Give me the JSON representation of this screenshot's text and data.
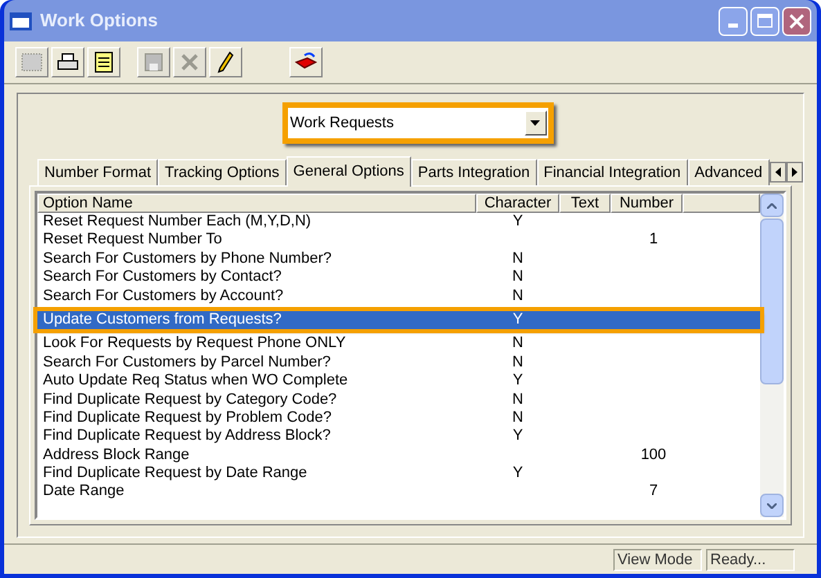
{
  "window": {
    "title": "Work Options"
  },
  "toolbar": [
    {
      "kind": "preview",
      "disabled": true
    },
    {
      "kind": "print",
      "disabled": false
    },
    {
      "kind": "document",
      "disabled": false
    },
    {
      "kind": "save",
      "disabled": true
    },
    {
      "kind": "delete",
      "disabled": true
    },
    {
      "kind": "edit",
      "disabled": false
    },
    {
      "kind": "exit",
      "disabled": false
    }
  ],
  "module_select": {
    "value": "Work Requests"
  },
  "tabs": [
    {
      "label": "Number Format",
      "selected": false
    },
    {
      "label": "Tracking Options",
      "selected": false
    },
    {
      "label": "General Options",
      "selected": true
    },
    {
      "label": "Parts Integration",
      "selected": false
    },
    {
      "label": "Financial Integration",
      "selected": false
    },
    {
      "label": "Advanced",
      "selected": false
    }
  ],
  "table": {
    "columns": [
      "Option Name",
      "Character",
      "Text",
      "Number"
    ],
    "rows": [
      {
        "name": "Reset Request Number Each (M,Y,D,N)",
        "character": "Y",
        "selected": false
      },
      {
        "name": "Reset Request Number To",
        "number": "1",
        "selected": false
      },
      {
        "name": "Search For Customers by Phone Number?",
        "character": "N",
        "selected": false
      },
      {
        "name": "Search For Customers by Contact?",
        "character": "N",
        "selected": false
      },
      {
        "name": "Search For Customers by Account?",
        "character": "N",
        "selected": false
      },
      {
        "name": "Update Customers from Requests?",
        "character": "Y",
        "selected": true
      },
      {
        "name": "Look For Requests by Request Phone ONLY",
        "character": "N",
        "selected": false
      },
      {
        "name": "Search For Customers by Parcel Number?",
        "character": "N",
        "selected": false
      },
      {
        "name": "Auto Update Req Status when WO Complete",
        "character": "Y",
        "selected": false
      },
      {
        "name": "Find Duplicate Request by Category Code?",
        "character": "N",
        "selected": false
      },
      {
        "name": "Find Duplicate Request by Problem Code?",
        "character": "N",
        "selected": false
      },
      {
        "name": "Find Duplicate Request by Address Block?",
        "character": "Y",
        "selected": false
      },
      {
        "name": "Address Block Range",
        "number": "100",
        "selected": false
      },
      {
        "name": "Find Duplicate Request by Date Range",
        "character": "Y",
        "selected": false
      },
      {
        "name": "Date Range",
        "number": "7",
        "selected": false
      }
    ]
  },
  "status_bar": [
    "View Mode",
    "Ready..."
  ]
}
